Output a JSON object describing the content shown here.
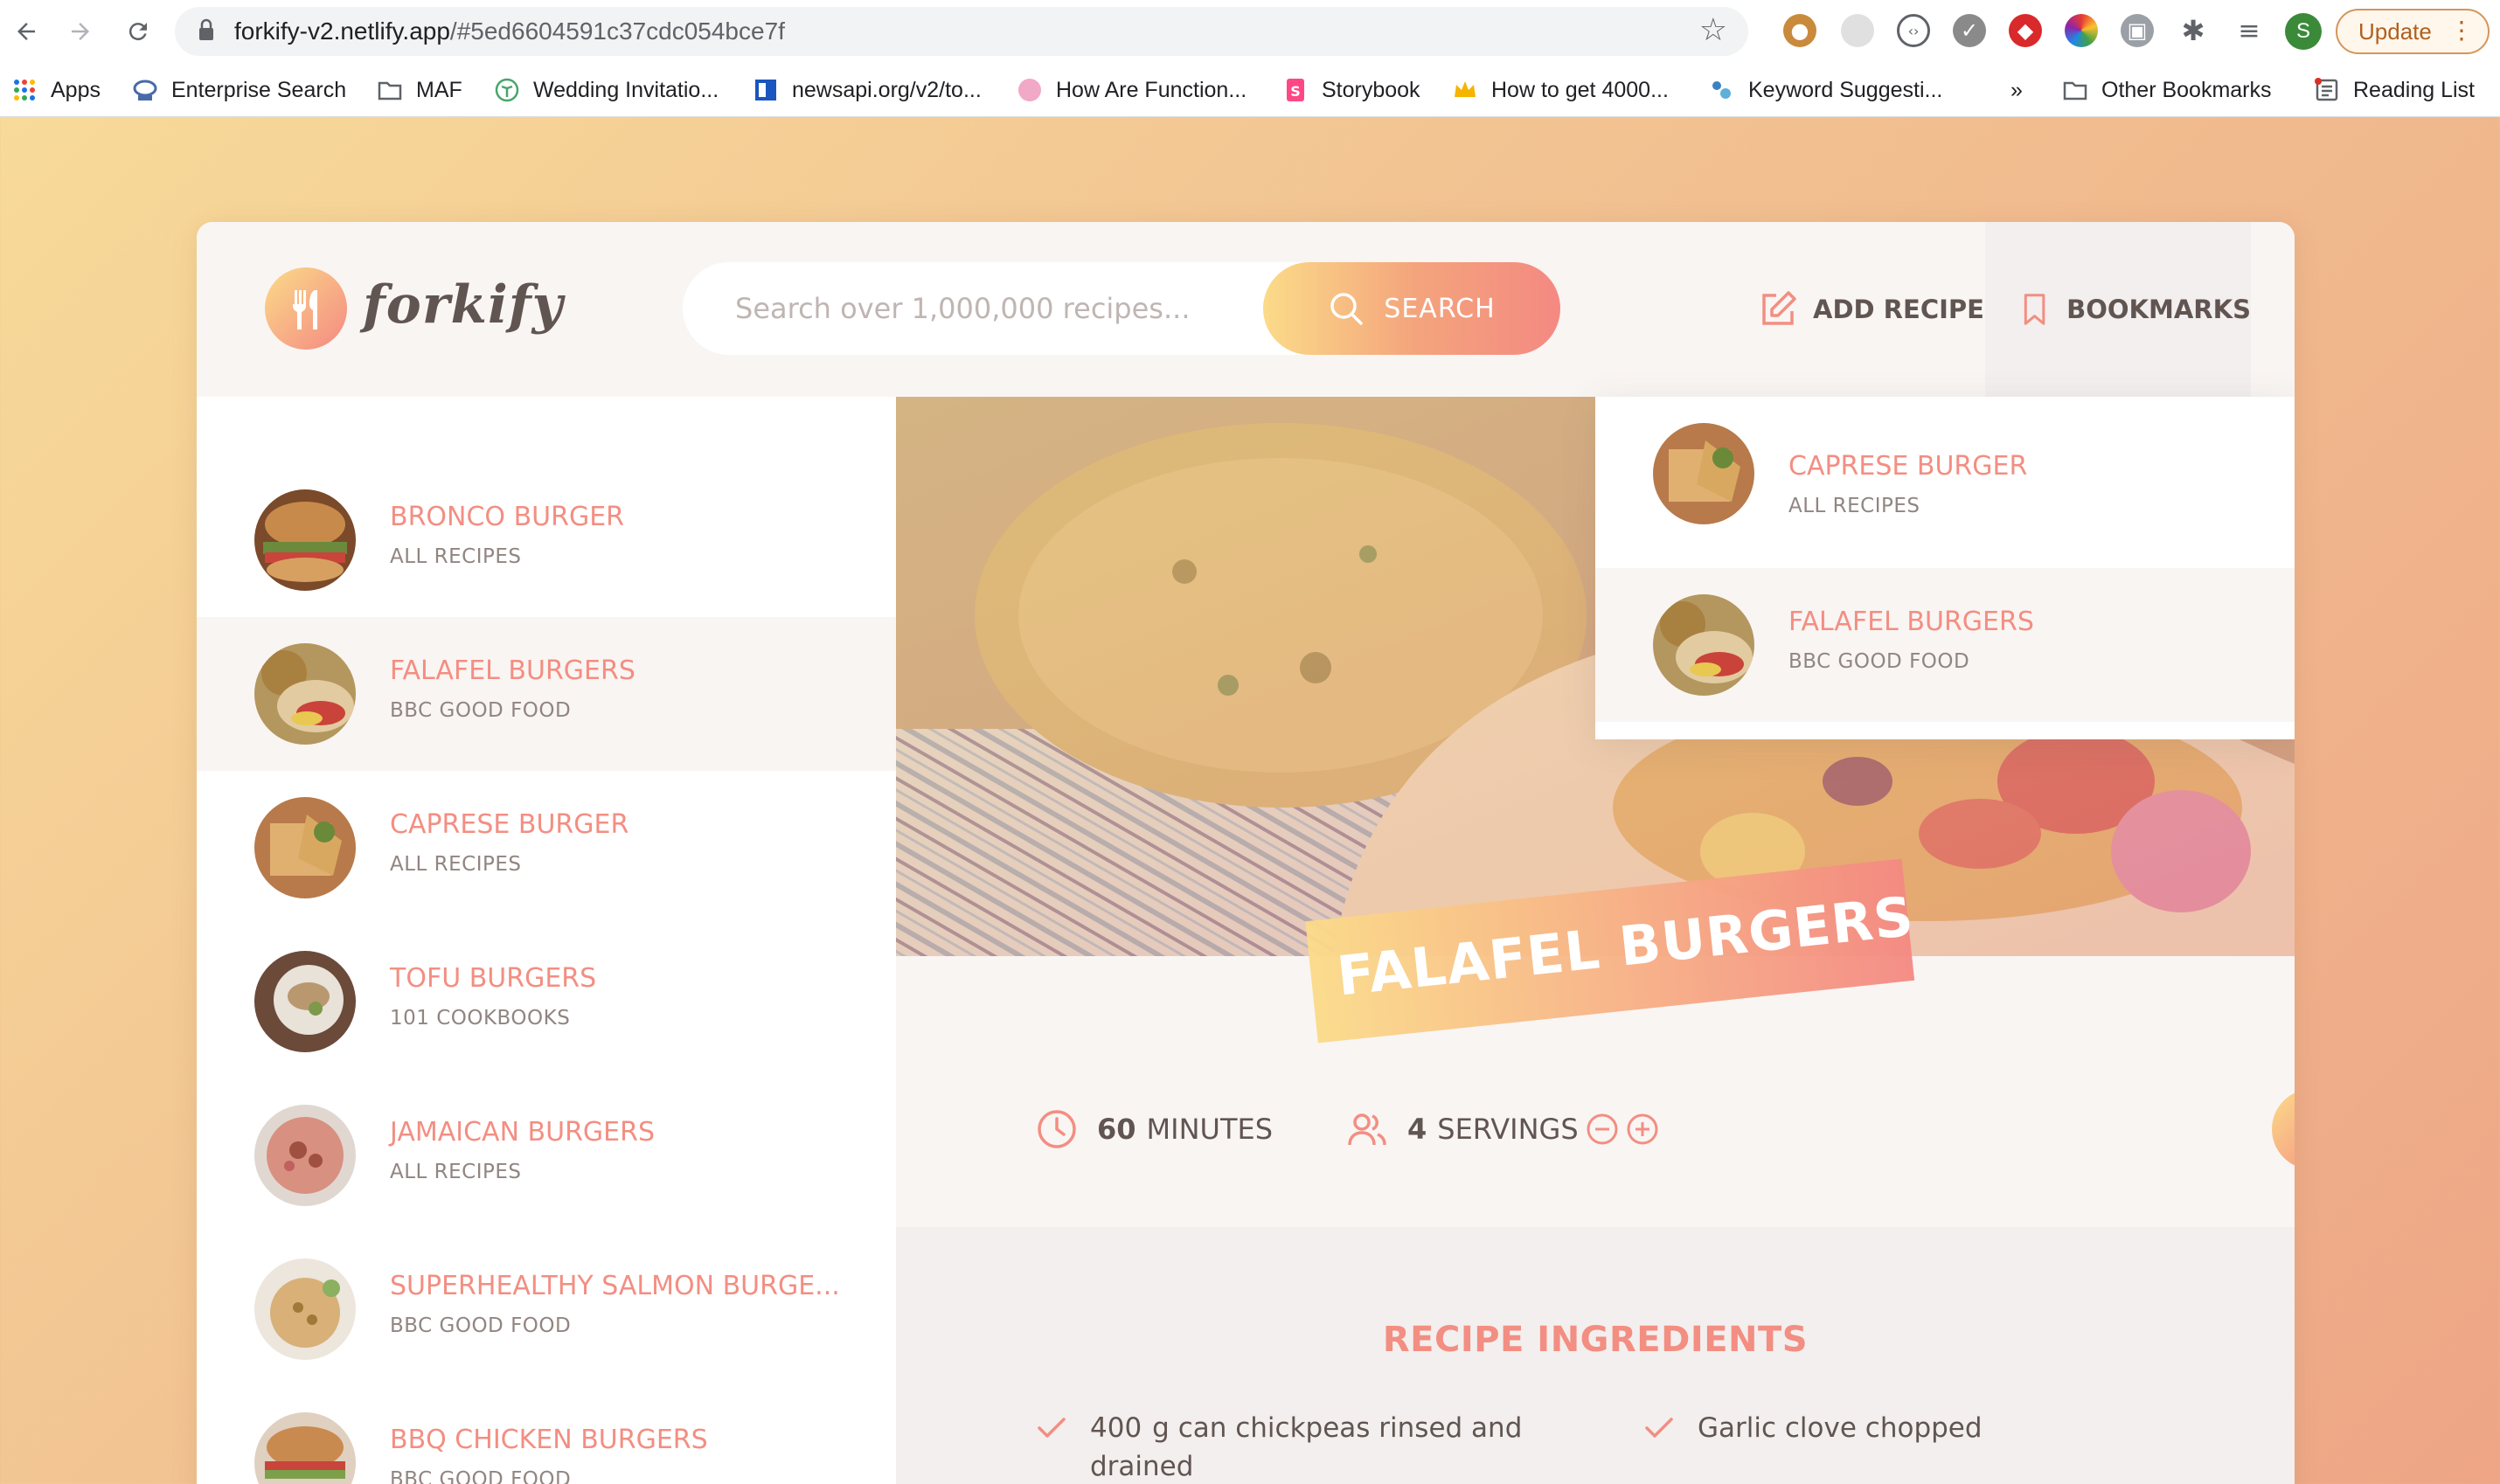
{
  "browser": {
    "url_host": "forkify-v2.netlify.app",
    "url_hash": "/#5ed6604591c37cdc054bce7f",
    "profile_initial": "S",
    "update_label": "Update",
    "bookmarks": [
      {
        "label": "Apps",
        "icon": "apps-grid-icon"
      },
      {
        "label": "Enterprise Search",
        "icon": "tata-icon"
      },
      {
        "label": "MAF",
        "icon": "folder-icon"
      },
      {
        "label": "Wedding Invitatio...",
        "icon": "palm-icon"
      },
      {
        "label": "newsapi.org/v2/to...",
        "icon": "doc-icon"
      },
      {
        "label": "How Are Function...",
        "icon": "circle-icon"
      },
      {
        "label": "Storybook",
        "icon": "storybook-icon"
      },
      {
        "label": "How to get 4000...",
        "icon": "crown-icon"
      },
      {
        "label": "Keyword Suggesti...",
        "icon": "dots-icon"
      },
      {
        "label": "»",
        "icon": "overflow-icon"
      },
      {
        "label": "Other Bookmarks",
        "icon": "folder-icon"
      },
      {
        "label": "Reading List",
        "icon": "reading-list-icon"
      }
    ]
  },
  "app": {
    "logo_text": "forkify",
    "search": {
      "placeholder": "Search over 1,000,000 recipes...",
      "button_label": "SEARCH"
    },
    "nav": {
      "add_recipe": "ADD RECIPE",
      "bookmarks": "BOOKMARKS"
    },
    "results": [
      {
        "title": "BRONCO BURGER",
        "publisher": "ALL RECIPES"
      },
      {
        "title": "FALAFEL BURGERS",
        "publisher": "BBC GOOD FOOD"
      },
      {
        "title": "CAPRESE BURGER",
        "publisher": "ALL RECIPES"
      },
      {
        "title": "TOFU BURGERS",
        "publisher": "101 COOKBOOKS"
      },
      {
        "title": "JAMAICAN BURGERS",
        "publisher": "ALL RECIPES"
      },
      {
        "title": "SUPERHEALTHY SALMON BURGE...",
        "publisher": "BBC GOOD FOOD"
      },
      {
        "title": "BBQ CHICKEN BURGERS",
        "publisher": "BBC GOOD FOOD"
      }
    ],
    "bookmarks_panel": [
      {
        "title": "CAPRESE BURGER",
        "publisher": "ALL RECIPES"
      },
      {
        "title": "FALAFEL BURGERS",
        "publisher": "BBC GOOD FOOD"
      }
    ],
    "recipe": {
      "title": "FALAFEL BURGERS",
      "cooking_time": "60",
      "time_unit": "MINUTES",
      "servings": "4",
      "servings_unit": "SERVINGS",
      "ingredients_heading": "RECIPE INGREDIENTS",
      "ingredients": [
        {
          "qty": "400",
          "text": "g can chickpeas rinsed and drained"
        },
        {
          "qty": "",
          "text": "Garlic clove chopped"
        }
      ]
    },
    "colors": {
      "accent": "#f38e82",
      "gradient_start": "#fbdb89",
      "gradient_end": "#f48982",
      "text": "#615551"
    }
  }
}
